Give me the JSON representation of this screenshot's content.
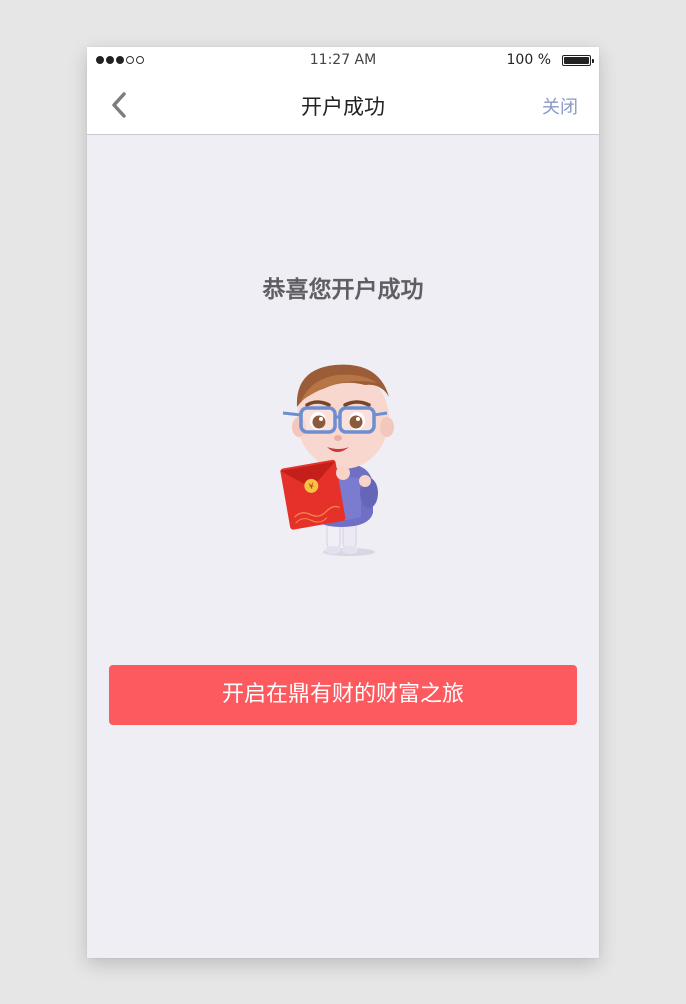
{
  "status_bar": {
    "signal_dots_filled": 3,
    "signal_dots_total": 5,
    "time": "11:27 AM",
    "battery_text": "100 %",
    "battery_level": 1.0
  },
  "nav": {
    "title": "开户成功",
    "close_label": "关闭",
    "back_icon": "chevron-left-icon"
  },
  "main": {
    "congrats_text": "恭喜您开户成功",
    "mascot": "mascot-holding-red-envelope",
    "cta_label": "开启在鼎有财的财富之旅"
  },
  "colors": {
    "background": "#efeef4",
    "accent_button": "#fd5a5f",
    "close_link": "#8a9ac6",
    "heading": "#5e5e63"
  }
}
